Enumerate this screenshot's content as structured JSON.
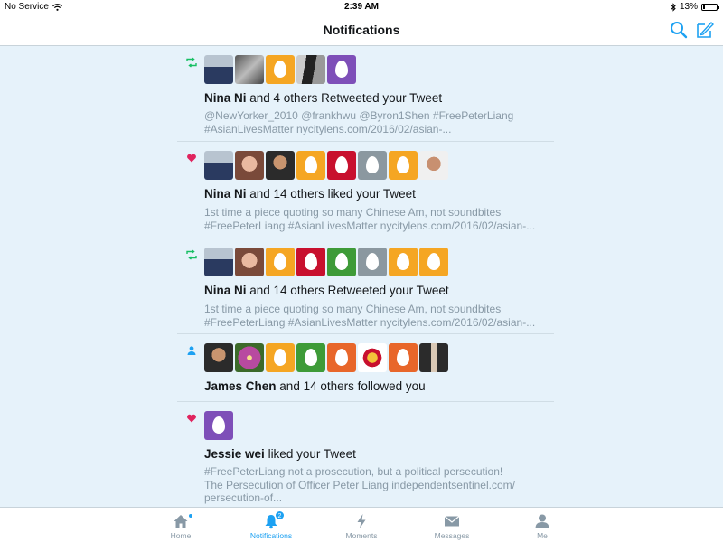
{
  "status": {
    "carrier": "No Service",
    "time": "2:39 AM",
    "battery": "13%",
    "battery_level": 0.13
  },
  "header": {
    "title": "Notifications"
  },
  "colors": {
    "accent": "#1da1f2",
    "retweet": "#17bf63",
    "like": "#e0245e",
    "follow": "#1da1f2",
    "egg_orange": "#f5a623",
    "egg_red": "#c8102e",
    "egg_green": "#3e9b38",
    "egg_gray": "#8b98a0",
    "egg_purple": "#7e4fb8",
    "egg_darkorange": "#e8662a"
  },
  "notifications": [
    {
      "type": "retweet",
      "type_icon": "retweet-icon",
      "name": "Nina Ni",
      "action": " and 4 others Retweeted your Tweet",
      "snippet": "@NewYorker_2010 @frankhwu @Byron1Shen #FreePeterLiang #AsianLivesMatter nycitylens.com/2016/02/asian-..."
    },
    {
      "type": "like",
      "type_icon": "heart-icon",
      "name": "Nina Ni",
      "action": " and 14 others liked your Tweet",
      "snippet": "1st time a piece quoting so many Chinese Am, not soundbites #FreePeterLiang #AsianLivesMatter nycitylens.com/2016/02/asian-..."
    },
    {
      "type": "retweet",
      "type_icon": "retweet-icon",
      "name": "Nina Ni",
      "action": " and 14 others Retweeted your Tweet",
      "snippet": "1st time a piece quoting so many Chinese Am, not soundbites #FreePeterLiang #AsianLivesMatter nycitylens.com/2016/02/asian-..."
    },
    {
      "type": "follow",
      "type_icon": "person-icon",
      "name": "James Chen",
      "action": " and 14 others followed you",
      "snippet": ""
    },
    {
      "type": "like",
      "type_icon": "heart-icon",
      "name": "Jessie wei",
      "action": " liked your Tweet",
      "snippet": "#FreePeterLiang not a prosecution, but a political persecution! The Persecution of Officer Peter Liang independentsentinel.com/ persecution-of..."
    }
  ],
  "tabs": [
    {
      "label": "Home",
      "icon": "home-icon"
    },
    {
      "label": "Notifications",
      "icon": "bell-icon",
      "badge": "2"
    },
    {
      "label": "Moments",
      "icon": "lightning-icon"
    },
    {
      "label": "Messages",
      "icon": "envelope-icon"
    },
    {
      "label": "Me",
      "icon": "person-icon"
    }
  ]
}
